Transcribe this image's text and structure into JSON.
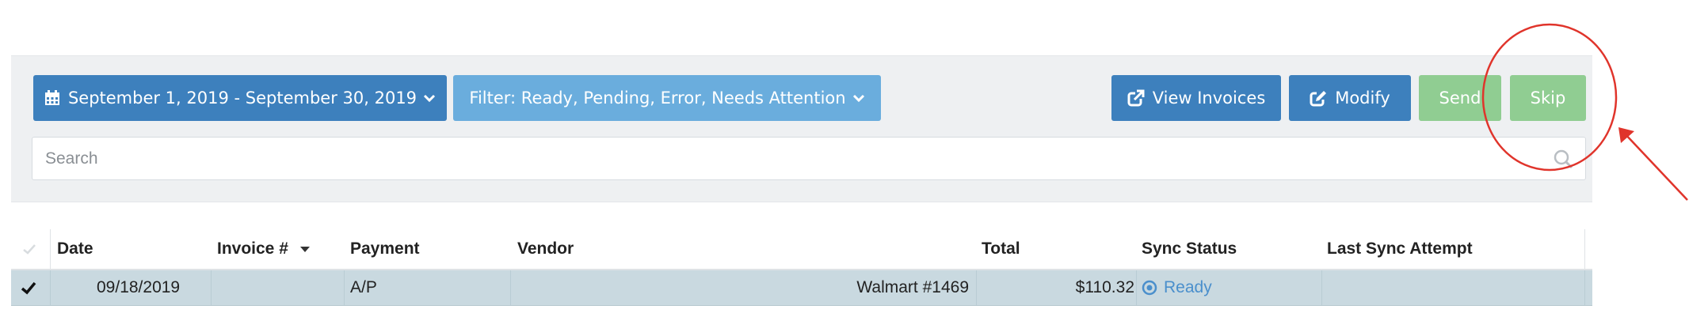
{
  "toolbar": {
    "date_range_label": "September 1, 2019 - September 30, 2019",
    "filter_label": "Filter: Ready, Pending, Error, Needs Attention",
    "view_invoices_label": "View Invoices",
    "modify_label": "Modify",
    "send_label": "Send",
    "skip_label": "Skip"
  },
  "search": {
    "placeholder": "Search"
  },
  "table": {
    "columns": [
      "Date",
      "Invoice #",
      "Payment",
      "Vendor",
      "Total",
      "Sync Status",
      "Last Sync Attempt"
    ],
    "rows": [
      {
        "date": "09/18/2019",
        "invoice": "",
        "payment": "A/P",
        "vendor": "Walmart #1469",
        "total": "$110.32",
        "sync_status": "Ready",
        "last_sync_attempt": ""
      }
    ]
  },
  "colors": {
    "primary_blue": "#3d80bd",
    "light_blue": "#6aaddd",
    "green": "#90cd92",
    "annotation_red": "#e0342b",
    "row_highlight": "#c9d9e0",
    "ready_blue": "#4a8fcc"
  },
  "icons": {
    "date": "calendar-icon",
    "view": "external-link-icon",
    "modify": "edit-icon",
    "search": "search-icon",
    "row_check": "checkmark-icon",
    "status": "target-icon"
  }
}
